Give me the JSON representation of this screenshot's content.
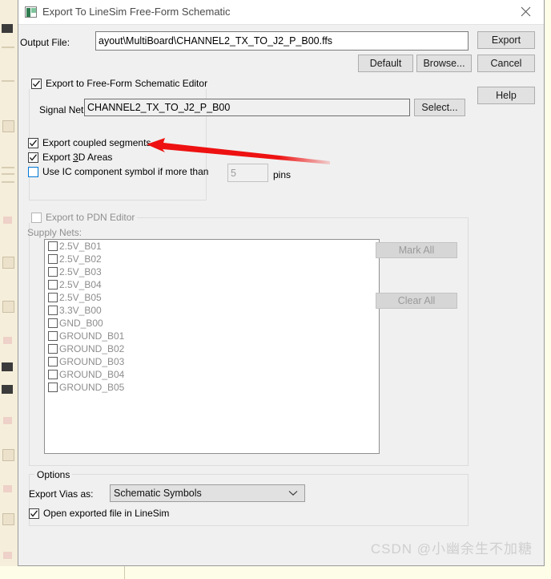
{
  "window": {
    "title": "Export To LineSim Free-Form Schematic",
    "icon": "app-squares-icon",
    "close_icon": "close-icon"
  },
  "output": {
    "label": "Output File:",
    "value": "ayout\\MultiBoard\\CHANNEL2_TX_TO_J2_P_B00.ffs",
    "default_label": "Default",
    "browse_label": "Browse..."
  },
  "right_buttons": {
    "export_label": "Export",
    "cancel_label": "Cancel",
    "help_label": "Help"
  },
  "freeform": {
    "group_label": "Export to Free-Form Schematic Editor",
    "group_checked": true,
    "signal_net_label": "Signal Net:",
    "signal_net_value": "CHANNEL2_TX_TO_J2_P_B00",
    "select_label": "Select...",
    "coupled_label": "Export coupled segments",
    "coupled_checked": true,
    "areas_label_pre": "Export ",
    "areas_label_underline": "3",
    "areas_label_post": "D Areas",
    "areas_checked": true,
    "ic_label": "Use IC component symbol if more than",
    "ic_checked": false,
    "pins_value": "5",
    "pins_label": "pins"
  },
  "pdn": {
    "group_label": "Export to PDN Editor",
    "group_checked": false,
    "supply_nets_label": "Supply Nets:",
    "mark_all_label": "Mark All",
    "clear_all_label": "Clear All",
    "nets": [
      "2.5V_B01",
      "2.5V_B02",
      "2.5V_B03",
      "2.5V_B04",
      "2.5V_B05",
      "3.3V_B00",
      "GND_B00",
      "GROUND_B01",
      "GROUND_B02",
      "GROUND_B03",
      "GROUND_B04",
      "GROUND_B05"
    ]
  },
  "options": {
    "group_label": "Options",
    "vias_label": "Export Vias as:",
    "vias_value": "Schematic Symbols",
    "vias_options": [
      "Schematic Symbols"
    ],
    "open_label": "Open exported file in LineSim",
    "open_checked": true
  },
  "annotation": {
    "arrow_color": "#ee1111",
    "arrow_name": "red-pointer-arrow"
  },
  "watermark": {
    "text": "CSDN @小幽余生不加糖"
  }
}
